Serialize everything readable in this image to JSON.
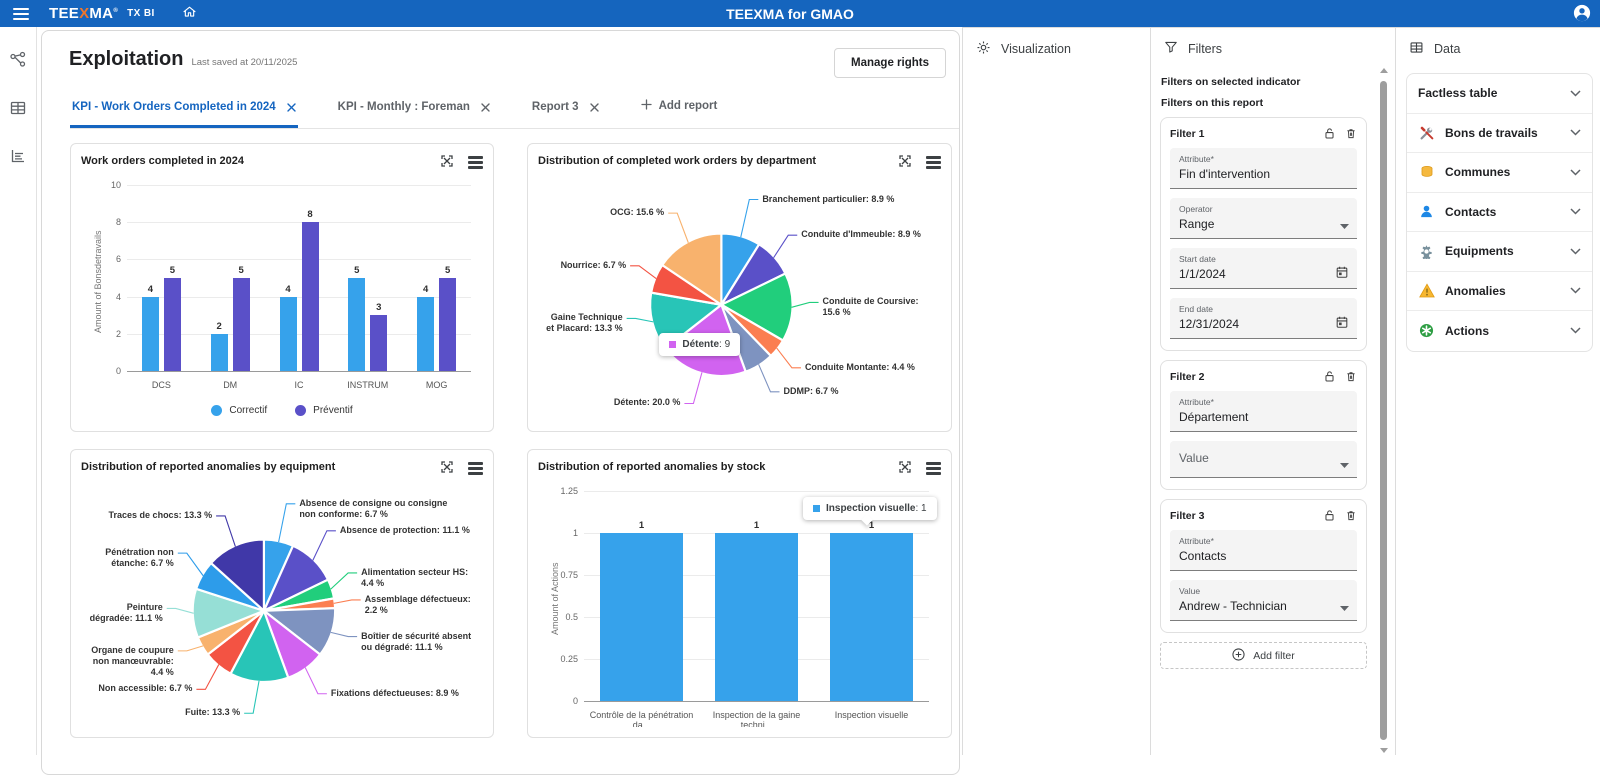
{
  "header": {
    "logo_t1": "TEE",
    "logo_x": "X",
    "logo_t2": "MA",
    "logo_reg": "®",
    "product": "TX BI",
    "title": "TEEXMA for GMAO"
  },
  "page": {
    "title": "Exploitation",
    "saved": "Last saved at 20/11/2025",
    "manage_rights": "Manage rights",
    "add_report": "Add report"
  },
  "tabs": [
    {
      "label": "KPI - Work Orders Completed in 2024",
      "active": true
    },
    {
      "label": "KPI - Monthly : Foreman",
      "active": false
    },
    {
      "label": "Report 3",
      "active": false
    }
  ],
  "colors": {
    "accent": "#1565C0",
    "bar_blue": "#36A2EB",
    "bar_purple": "#5A50C8"
  },
  "chart_data": [
    {
      "type": "bar",
      "slug": "work-orders-2024",
      "title": "Work orders completed in 2024",
      "ylabel": "Amount of Bonsdetravails",
      "ylim": [
        0,
        10
      ],
      "yticks": [
        0,
        2,
        4,
        6,
        8,
        10
      ],
      "categories": [
        "DCS",
        "DM",
        "IC",
        "INSTRUM",
        "MOG"
      ],
      "series": [
        {
          "name": "Correctif",
          "color": "#36A2EB",
          "values": [
            4,
            2,
            4,
            5,
            4
          ]
        },
        {
          "name": "Préventif",
          "color": "#5A50C8",
          "values": [
            5,
            5,
            8,
            3,
            5
          ]
        }
      ],
      "legend_position": "bottom",
      "grid": true
    },
    {
      "type": "pie",
      "slug": "work-orders-by-department",
      "title": "Distribution of completed work orders by department",
      "unit": "%",
      "slices": [
        {
          "label": "Branchement particulier",
          "pct": 8.9,
          "color": "#36A2EB"
        },
        {
          "label": "Conduite d'Immeuble",
          "pct": 8.9,
          "color": "#5A50C8"
        },
        {
          "label": "Conduite de Coursive",
          "pct": 15.6,
          "color": "#21CE7C"
        },
        {
          "label": "Conduite Montante",
          "pct": 4.4,
          "color": "#FB7E51"
        },
        {
          "label": "DDMP",
          "pct": 6.7,
          "color": "#7E93C0"
        },
        {
          "label": "Détente",
          "pct": 20.0,
          "color": "#D163F0"
        },
        {
          "label": "Gaine Technique et Placard",
          "pct": 13.3,
          "color": "#28C5B7"
        },
        {
          "label": "Nourrice",
          "pct": 6.7,
          "color": "#F35343"
        },
        {
          "label": "OCG",
          "pct": 15.6,
          "color": "#F8B26D"
        }
      ],
      "tooltip": {
        "name": "Détente",
        "value": 9,
        "color": "#D163F0"
      }
    },
    {
      "type": "pie",
      "slug": "anomalies-by-equipment",
      "title": "Distribution of reported anomalies by equipment",
      "unit": "%",
      "slices": [
        {
          "label": "Absence de consigne ou consigne non conforme",
          "pct": 6.7,
          "color": "#36A2EB"
        },
        {
          "label": "Absence de protection",
          "pct": 11.1,
          "color": "#5A50C8"
        },
        {
          "label": "Alimentation secteur HS",
          "pct": 4.4,
          "color": "#21CE7C"
        },
        {
          "label": "Assemblage défectueux",
          "pct": 2.2,
          "color": "#FB7E51"
        },
        {
          "label": "Boîtier de sécurité absent ou dégradé",
          "pct": 11.1,
          "color": "#7E93C0"
        },
        {
          "label": "Fixations défectueuses",
          "pct": 8.9,
          "color": "#D163F0"
        },
        {
          "label": "Fuite",
          "pct": 13.3,
          "color": "#28C5B7"
        },
        {
          "label": "Non accessible",
          "pct": 6.7,
          "color": "#F35343"
        },
        {
          "label": "Organe de coupure non manœuvrable",
          "pct": 4.4,
          "color": "#F8B26D"
        },
        {
          "label": "Peinture dégradée",
          "pct": 11.1,
          "color": "#96DFD6"
        },
        {
          "label": "Pénétration non étanche",
          "pct": 6.7,
          "color": "#2D9CEA"
        },
        {
          "label": "Traces de chocs",
          "pct": 13.3,
          "color": "#4038A8"
        }
      ]
    },
    {
      "type": "bar",
      "slug": "anomalies-by-stock",
      "title": "Distribution of reported anomalies by stock",
      "ylabel": "Amount of Actions",
      "ylim": [
        0,
        1.25
      ],
      "yticks": [
        0,
        0.25,
        0.5,
        0.75,
        1,
        1.25
      ],
      "categories": [
        "Contrôle de la pénétration da...",
        "Inspection de la gaine techni...",
        "Inspection visuelle"
      ],
      "series": [
        {
          "name": "Actions",
          "color": "#36A2EB",
          "values": [
            1,
            1,
            1
          ]
        }
      ],
      "legend_position": "none",
      "grid": true,
      "tooltip": {
        "name": "Inspection visuelle",
        "value": 1,
        "color": "#36A2EB",
        "bar_index": 2
      }
    }
  ],
  "panels": {
    "visualization": {
      "title": "Visualization"
    },
    "filters": {
      "title": "Filters",
      "section1": "Filters on selected indicator",
      "section2": "Filters on this report",
      "add_filter": "Add filter",
      "items": [
        {
          "name": "Filter 1",
          "fields": [
            {
              "label": "Attribute*",
              "value": "Fin d'intervention",
              "type": "text"
            },
            {
              "label": "Operator",
              "value": "Range",
              "type": "select"
            },
            {
              "label": "Start date",
              "value": "1/1/2024",
              "type": "date"
            },
            {
              "label": "End date",
              "value": "12/31/2024",
              "type": "date"
            }
          ]
        },
        {
          "name": "Filter 2",
          "fields": [
            {
              "label": "Attribute*",
              "value": "Département",
              "type": "text"
            },
            {
              "label": "Value",
              "value": "",
              "type": "select"
            }
          ]
        },
        {
          "name": "Filter 3",
          "fields": [
            {
              "label": "Attribute*",
              "value": "Contacts",
              "type": "text"
            },
            {
              "label": "Value",
              "value": "Andrew - Technician",
              "type": "select"
            }
          ]
        }
      ]
    },
    "data": {
      "title": "Data",
      "items": [
        {
          "label": "Factless table",
          "icon": null
        },
        {
          "label": "Bons de travails",
          "icon": "tools-icon"
        },
        {
          "label": "Communes",
          "icon": "coins-icon"
        },
        {
          "label": "Contacts",
          "icon": "person-icon"
        },
        {
          "label": "Equipments",
          "icon": "gear-icon"
        },
        {
          "label": "Anomalies",
          "icon": "warning-icon"
        },
        {
          "label": "Actions",
          "icon": "asterisk-icon"
        }
      ]
    }
  }
}
